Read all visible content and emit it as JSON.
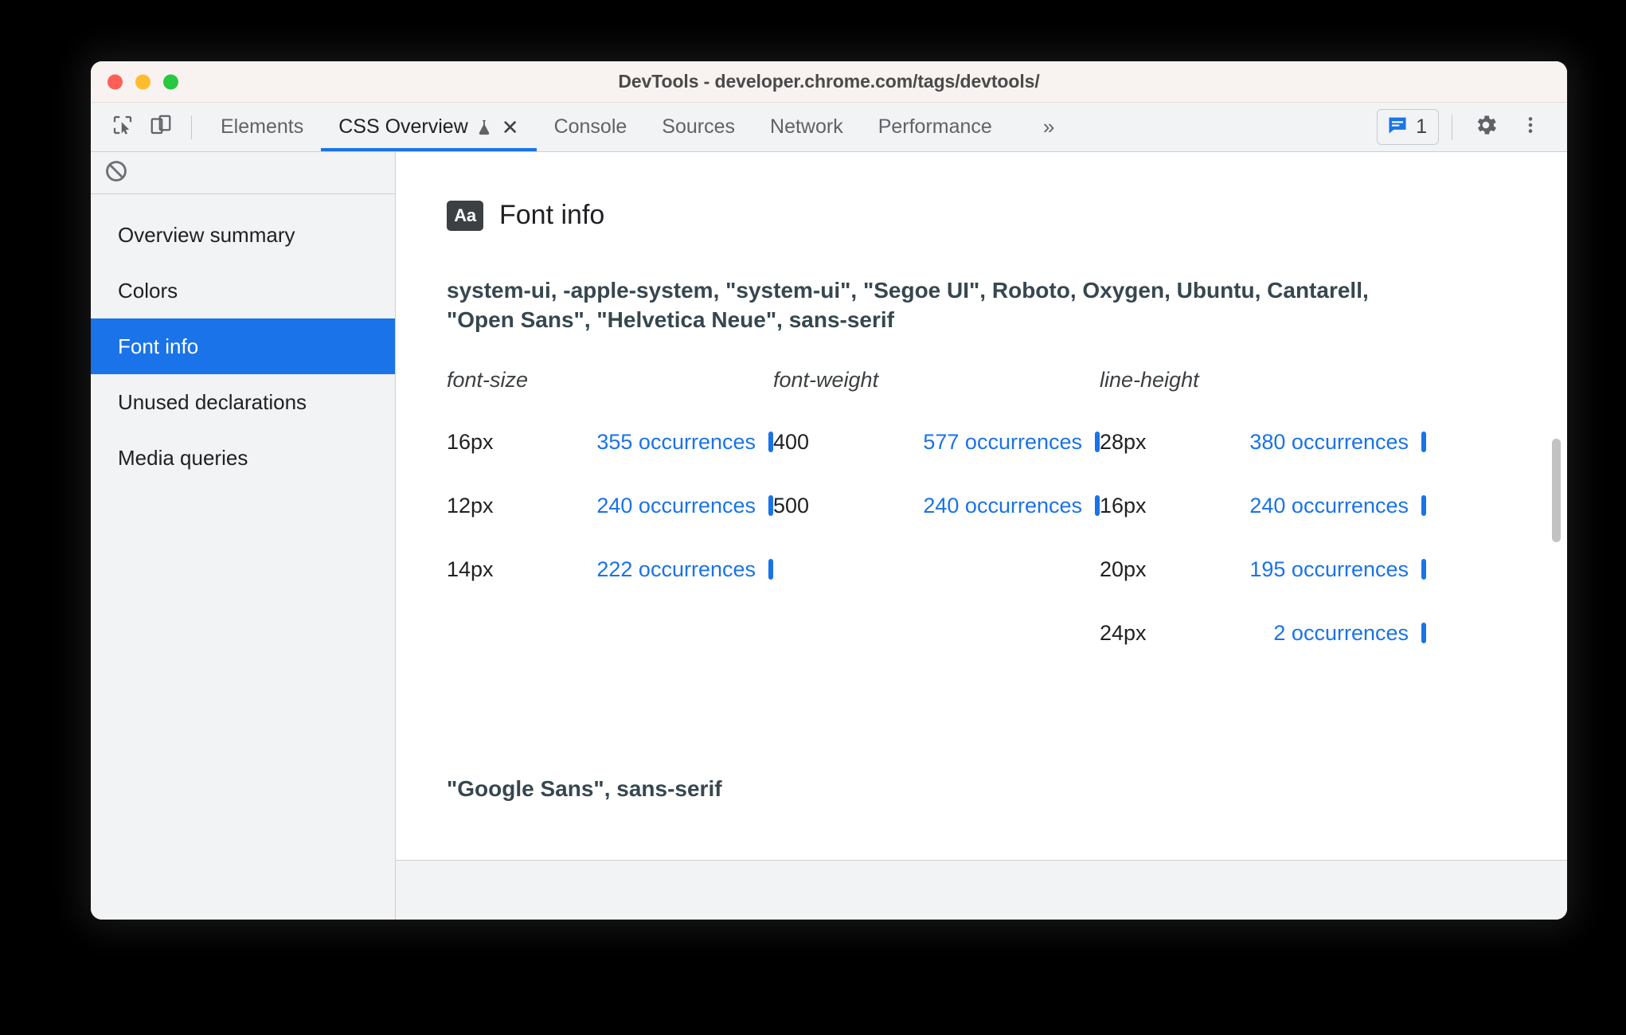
{
  "window": {
    "title": "DevTools - developer.chrome.com/tags/devtools/",
    "traffic_lights": [
      {
        "name": "close",
        "color": "#ff5f57"
      },
      {
        "name": "minimize",
        "color": "#febc2e"
      },
      {
        "name": "maximize",
        "color": "#28c840"
      }
    ]
  },
  "toolbar": {
    "inspect_icon": "inspect-element-icon",
    "device_icon": "device-toolbar-icon",
    "overflow_label": "»",
    "issues": {
      "icon": "issues-message-icon",
      "count": "1"
    },
    "settings_icon": "gear-icon",
    "menu_icon": "vertical-dots-icon"
  },
  "tabs": [
    {
      "label": "Elements",
      "active": false
    },
    {
      "label": "CSS Overview",
      "active": true,
      "experimental": true,
      "closable": true
    },
    {
      "label": "Console",
      "active": false
    },
    {
      "label": "Sources",
      "active": false
    },
    {
      "label": "Network",
      "active": false
    },
    {
      "label": "Performance",
      "active": false
    }
  ],
  "sidebar": {
    "clear_icon": "block-clear-icon",
    "items": [
      {
        "label": "Overview summary",
        "selected": false
      },
      {
        "label": "Colors",
        "selected": false
      },
      {
        "label": "Font info",
        "selected": true
      },
      {
        "label": "Unused declarations",
        "selected": false
      },
      {
        "label": "Media queries",
        "selected": false
      }
    ]
  },
  "main": {
    "badge": "Aa",
    "section_title": "Font info",
    "font_family_primary": "system-ui, -apple-system, \"system-ui\", \"Segoe UI\", Roboto, Oxygen, Ubuntu, Cantarell, \"Open Sans\", \"Helvetica Neue\", sans-serif",
    "font_family_secondary": "\"Google Sans\", sans-serif",
    "columns": [
      {
        "header": "font-size"
      },
      {
        "header": "font-weight"
      },
      {
        "header": "line-height"
      }
    ],
    "font_size_rows": [
      {
        "key": "16px",
        "value": "355 occurrences"
      },
      {
        "key": "12px",
        "value": "240 occurrences"
      },
      {
        "key": "14px",
        "value": "222 occurrences"
      }
    ],
    "font_weight_rows": [
      {
        "key": "400",
        "value": "577 occurrences"
      },
      {
        "key": "500",
        "value": "240 occurrences"
      }
    ],
    "line_height_rows": [
      {
        "key": "28px",
        "value": "380 occurrences"
      },
      {
        "key": "16px",
        "value": "240 occurrences"
      },
      {
        "key": "20px",
        "value": "195 occurrences"
      },
      {
        "key": "24px",
        "value": "2 occurrences"
      }
    ]
  },
  "colors": {
    "accent_blue": "#1a73e8",
    "selected_row_bg": "#1a73e8",
    "panel_bg": "#f1f3f4",
    "titlebar_bg": "#f8f2f0",
    "text_dark": "#202124",
    "text_muted": "#5f6368"
  }
}
